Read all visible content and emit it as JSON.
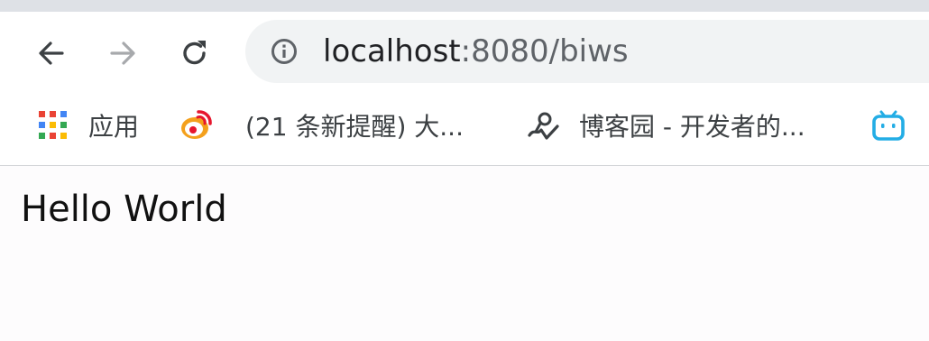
{
  "toolbar": {
    "back_icon": "back-arrow-icon",
    "forward_icon": "forward-arrow-icon",
    "reload_icon": "reload-icon"
  },
  "address_bar": {
    "host": "localhost",
    "rest": ":8080/biws",
    "info_icon": "info-icon"
  },
  "bookmarks": {
    "items": [
      {
        "label": "应用",
        "icon": "apps-grid-icon"
      },
      {
        "label": "(21 条新提醒)  大...",
        "icon": "weibo-icon"
      },
      {
        "label": "博客园 - 开发者的...",
        "icon": "cnblogs-icon"
      },
      {
        "label": "",
        "icon": "bilibili-icon"
      }
    ]
  },
  "page": {
    "text": "Hello World"
  },
  "colors": {
    "tab_strip": "#dee1e6",
    "omnibox": "#f1f3f4",
    "accent_bilibili": "#23ade5",
    "apps_red": "#ea4335",
    "apps_blue": "#4285f4",
    "apps_green": "#34a853",
    "apps_yellow": "#fbbc05"
  }
}
